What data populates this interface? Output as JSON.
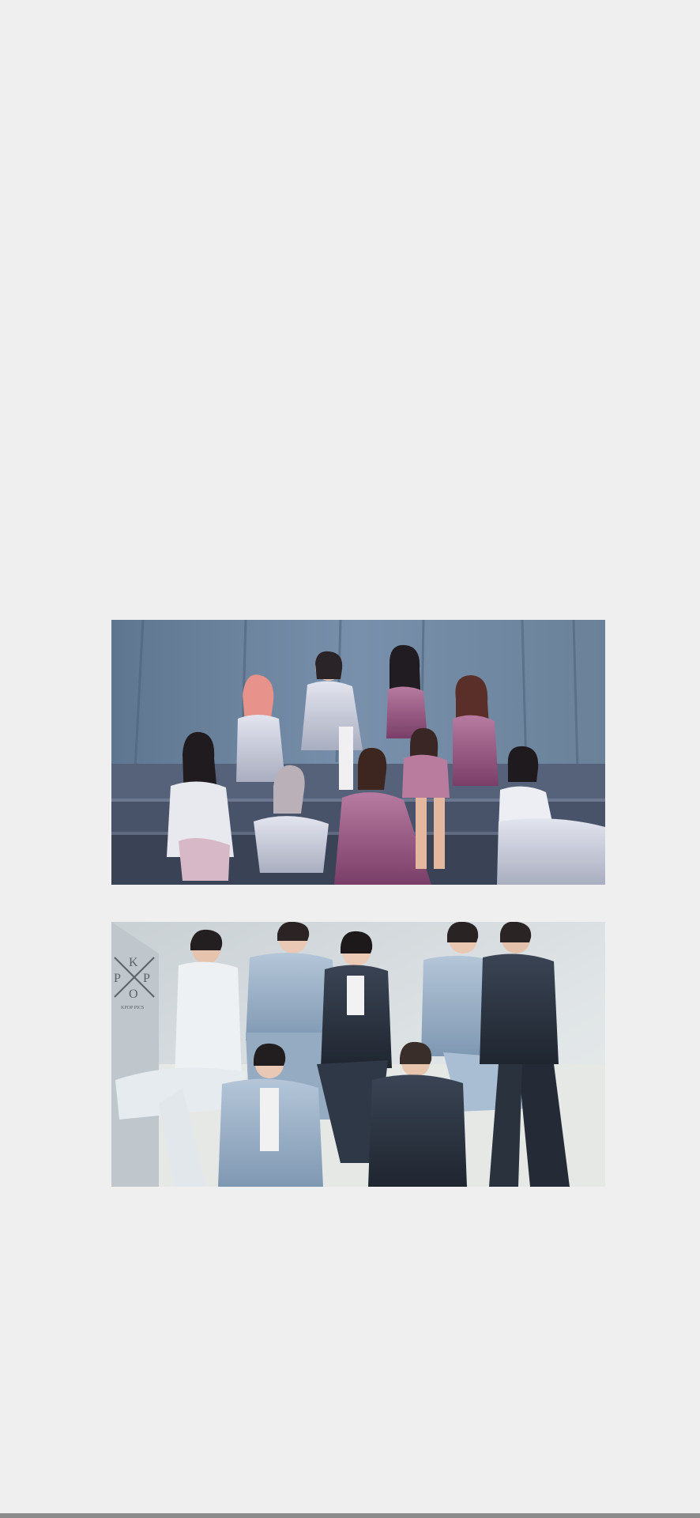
{
  "gallery": {
    "background_color": "#efefef",
    "images": [
      {
        "subject": "group photo of nine women in satin outfits seated on steps in front of a blue curtain",
        "palette": {
          "curtain": "#6d84a0",
          "steps": "#4a5568",
          "satin_silver": "#c9ccd8",
          "satin_mauve": "#9a5d86"
        }
      },
      {
        "subject": "group photo of seven men in denim outfits posed in a bright corner",
        "palette": {
          "wall": "#d8dde0",
          "denim_light": "#a9bdd2",
          "denim_dark": "#2b3340",
          "white_outfit": "#e9eef2"
        },
        "watermark": {
          "letters": [
            "K",
            "P",
            "P",
            "O"
          ],
          "caption": "KPOP PICS"
        }
      }
    ]
  },
  "system": {
    "home_indicator_color": "#8b8b8b"
  }
}
